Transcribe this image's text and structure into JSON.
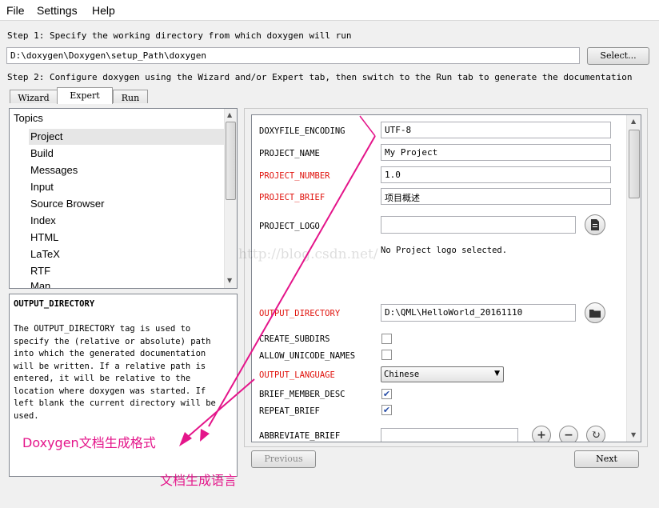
{
  "menu": [
    "File",
    "Settings",
    "Help"
  ],
  "step1": {
    "text": "Step 1: Specify the working directory from which doxygen will run",
    "path": "D:\\doxygen\\Doxygen\\setup_Path\\doxygen",
    "select_label": "Select..."
  },
  "step2": {
    "text": "Step 2: Configure doxygen using the Wizard and/or Expert tab, then switch to the Run tab to generate the documentation"
  },
  "tabs": [
    "Wizard",
    "Expert",
    "Run"
  ],
  "topics": {
    "header": "Topics",
    "items": [
      "Project",
      "Build",
      "Messages",
      "Input",
      "Source Browser",
      "Index",
      "HTML",
      "LaTeX",
      "RTF",
      "Man"
    ],
    "selected": "Project"
  },
  "help": {
    "title": "OUTPUT_DIRECTORY",
    "lines": [
      "The OUTPUT_DIRECTORY tag is used to",
      "specify the (relative or absolute) path",
      "into which the generated documentation",
      "will be written. If a relative path is",
      "entered, it will be relative to the",
      "location where doxygen was started. If",
      "left blank the current directory will be",
      "used."
    ]
  },
  "form": {
    "doxyfile_encoding": {
      "label": "DOXYFILE_ENCODING",
      "value": "UTF-8"
    },
    "project_name": {
      "label": "PROJECT_NAME",
      "value": "My Project"
    },
    "project_number": {
      "label": "PROJECT_NUMBER",
      "value": "1.0"
    },
    "project_brief": {
      "label": "PROJECT_BRIEF",
      "value": "项目概述"
    },
    "project_logo": {
      "label": "PROJECT_LOGO",
      "value": "",
      "status": "No Project logo selected."
    },
    "output_directory": {
      "label": "OUTPUT_DIRECTORY",
      "value": "D:\\QML\\HelloWorld_20161110"
    },
    "create_subdirs": {
      "label": "CREATE_SUBDIRS",
      "checked": false
    },
    "allow_unicode_names": {
      "label": "ALLOW_UNICODE_NAMES",
      "checked": false
    },
    "output_language": {
      "label": "OUTPUT_LANGUAGE",
      "value": "Chinese"
    },
    "brief_member_desc": {
      "label": "BRIEF_MEMBER_DESC",
      "checked": true
    },
    "repeat_brief": {
      "label": "REPEAT_BRIEF",
      "checked": true
    },
    "abbreviate_brief": {
      "label": "ABBREVIATE_BRIEF",
      "value": ""
    }
  },
  "nav": {
    "previous": "Previous",
    "next": "Next"
  },
  "watermark": "http://blog.csdn.net/",
  "annotations": {
    "format": "Doxygen文档生成格式",
    "language": "文档生成语言",
    "color": "#e4158a"
  },
  "colors": {
    "required_label": "#e0140e",
    "selection": "#e6e6e6"
  },
  "icons": {
    "file_button": "document-icon",
    "folder_button": "folder-icon",
    "add": "plus-icon",
    "remove": "minus-icon",
    "reset": "refresh-icon"
  }
}
